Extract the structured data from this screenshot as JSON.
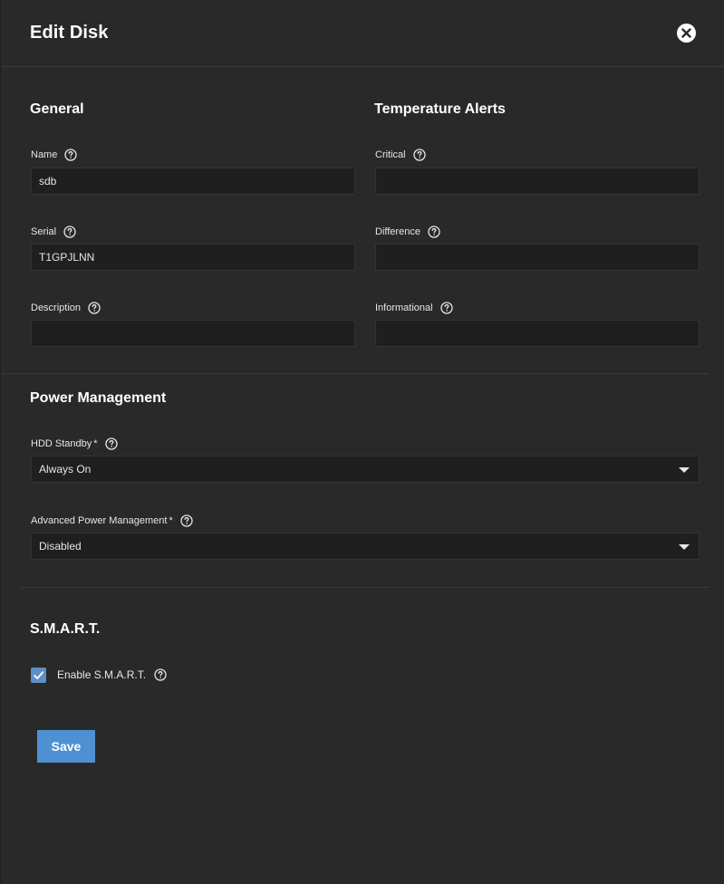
{
  "dialog": {
    "title": "Edit Disk"
  },
  "general": {
    "heading": "General",
    "name": {
      "label": "Name",
      "value": "sdb"
    },
    "serial": {
      "label": "Serial",
      "value": "T1GPJLNN"
    },
    "description": {
      "label": "Description",
      "value": ""
    }
  },
  "temperature_alerts": {
    "heading": "Temperature Alerts",
    "critical": {
      "label": "Critical",
      "value": ""
    },
    "difference": {
      "label": "Difference",
      "value": ""
    },
    "informational": {
      "label": "Informational",
      "value": ""
    }
  },
  "power_management": {
    "heading": "Power Management",
    "hdd_standby": {
      "label": "HDD Standby",
      "required_mark": "*",
      "value": "Always On"
    },
    "apm": {
      "label": "Advanced Power Management",
      "required_mark": "*",
      "value": "Disabled"
    }
  },
  "smart": {
    "heading": "S.M.A.R.T.",
    "enable": {
      "label": "Enable S.M.A.R.T.",
      "checked": true
    }
  },
  "actions": {
    "save_label": "Save"
  },
  "colors": {
    "background": "#292929",
    "input_background": "#1f1f1f",
    "accent": "#4f90d2",
    "checkbox": "#5b8fc7"
  },
  "icons": {
    "close": "close-icon",
    "help": "help-icon",
    "dropdown": "chevron-down-icon",
    "check": "check-icon"
  }
}
